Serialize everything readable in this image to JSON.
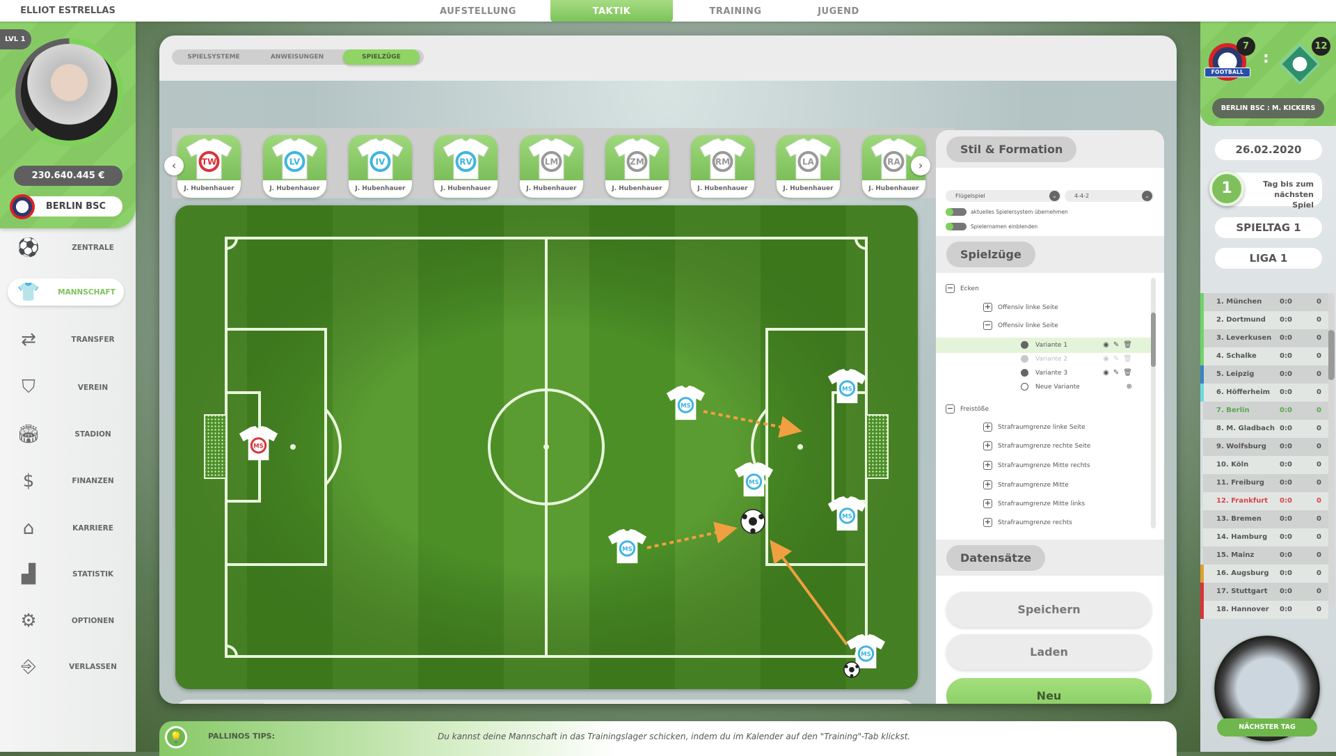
{
  "user": {
    "name": "ELLIOT ESTRELLAS",
    "level": "LVL 1",
    "level_progress": 0.62,
    "money": "230.640.445 €",
    "club": "BERLIN BSC"
  },
  "top_tabs": [
    {
      "label": "AUFSTELLUNG",
      "active": false
    },
    {
      "label": "TAKTIK",
      "active": true
    },
    {
      "label": "TRAINING",
      "active": false
    },
    {
      "label": "JUGEND",
      "active": false
    }
  ],
  "nav": [
    {
      "label": "ZENTRALE",
      "icon": "football-icon",
      "glyph": "⚽",
      "active": false
    },
    {
      "label": "MANNSCHAFT",
      "icon": "jerseys-icon",
      "glyph": "👕",
      "active": true
    },
    {
      "label": "TRANSFER",
      "icon": "transfer-icon",
      "glyph": "⇄",
      "active": false
    },
    {
      "label": "VEREIN",
      "icon": "club-shield-icon",
      "glyph": "⛉",
      "active": false
    },
    {
      "label": "STADION",
      "icon": "stadium-icon",
      "glyph": "🏟",
      "active": false
    },
    {
      "label": "FINANZEN",
      "icon": "money-icon",
      "glyph": "$",
      "active": false
    },
    {
      "label": "KARRIERE",
      "icon": "home-icon",
      "glyph": "⌂",
      "active": false
    },
    {
      "label": "STATISTIK",
      "icon": "statistics-icon",
      "glyph": "▟",
      "active": false
    },
    {
      "label": "OPTIONEN",
      "icon": "gear-icon",
      "glyph": "⚙",
      "active": false
    },
    {
      "label": "VERLASSEN",
      "icon": "exit-door-icon",
      "glyph": "⎆",
      "active": false
    }
  ],
  "subtabs": [
    {
      "label": "SPIELSYSTEME",
      "active": false
    },
    {
      "label": "ANWEISUNGEN",
      "active": false
    },
    {
      "label": "SPIELZÜGE",
      "active": true
    }
  ],
  "player_cards": [
    {
      "pos": "TW",
      "name": "J. Hubenhauer",
      "color": "#d9333a"
    },
    {
      "pos": "LV",
      "name": "J. Hubenhauer",
      "color": "#3fb5e0"
    },
    {
      "pos": "IV",
      "name": "J. Hubenhauer",
      "color": "#3fb5e0"
    },
    {
      "pos": "RV",
      "name": "J. Hubenhauer",
      "color": "#3fb5e0"
    },
    {
      "pos": "LM",
      "name": "J. Hubenhauer",
      "color": "#999999"
    },
    {
      "pos": "ZM",
      "name": "J. Hubenhauer",
      "color": "#999999"
    },
    {
      "pos": "RM",
      "name": "J. Hubenhauer",
      "color": "#999999"
    },
    {
      "pos": "LA",
      "name": "J. Hubenhauer",
      "color": "#999999"
    },
    {
      "pos": "RA",
      "name": "J. Hubenhauer",
      "color": "#999999"
    }
  ],
  "pitch_players": [
    {
      "label": "MS",
      "color": "#d9333a"
    },
    {
      "label": "MS",
      "color": "#3fb5e0"
    },
    {
      "label": "MS",
      "color": "#3fb5e0"
    },
    {
      "label": "MS",
      "color": "#3fb5e0"
    },
    {
      "label": "MS",
      "color": "#3fb5e0"
    },
    {
      "label": "MS",
      "color": "#3fb5e0"
    },
    {
      "label": "MS",
      "color": "#3fb5e0"
    }
  ],
  "timeline": {
    "total_steps": 14,
    "marked_steps": [
      3,
      7
    ]
  },
  "settings": {
    "style_title": "Stil & Formation",
    "style_value": "Flügelspiel",
    "formation_value": "4-4-2",
    "toggle1": "aktuelles Spielersystem übernehmen",
    "toggle2": "Spielernamen einblenden",
    "plays_title": "Spielzüge",
    "tree": [
      {
        "level": 0,
        "type": "minus",
        "label": "Ecken"
      },
      {
        "level": 1,
        "type": "plus",
        "label": "Offensiv linke Seite"
      },
      {
        "level": 1,
        "type": "minus",
        "label": "Offensiv linke Seite"
      },
      {
        "level": 2,
        "type": "dot",
        "label": "Variante 1",
        "state": "selected"
      },
      {
        "level": 2,
        "type": "dot",
        "label": "Variante 2",
        "state": "disabled"
      },
      {
        "level": 2,
        "type": "dot",
        "label": "Variante 3",
        "state": "normal"
      },
      {
        "level": 2,
        "type": "new",
        "label": "Neue Variante",
        "state": "new"
      },
      {
        "level": 0,
        "type": "minus",
        "label": "Freistöße"
      },
      {
        "level": 1,
        "type": "plus",
        "label": "Strafraumgrenze linke Seite"
      },
      {
        "level": 1,
        "type": "plus",
        "label": "Strafraumgrenze rechte Seite"
      },
      {
        "level": 1,
        "type": "plus",
        "label": "Strafraumgrenze Mitte rechts"
      },
      {
        "level": 1,
        "type": "plus",
        "label": "Strafraumgrenze Mitte"
      },
      {
        "level": 1,
        "type": "plus",
        "label": "Strafraumgrenze Mitte links"
      },
      {
        "level": 1,
        "type": "plus",
        "label": "Strafraumgrenze rechts"
      }
    ],
    "data_title": "Datensätze",
    "save": "Speichern",
    "load": "Laden",
    "new": "Neu"
  },
  "match": {
    "home_rank": "7",
    "away_rank": "12",
    "separator": ":",
    "label": "BERLIN BSC : M. KICKERS",
    "home_badge_text": "FOOTBALL",
    "date": "26.02.2020",
    "days": "1",
    "days_label": "Tag bis zum nächsten Spiel",
    "matchday": "SPIELTAG 1",
    "league": "LIGA 1"
  },
  "standings": [
    {
      "pos": "1.",
      "team": "München",
      "score": "0:0",
      "pts": "0",
      "zone": "#6fd36a"
    },
    {
      "pos": "2.",
      "team": "Dortmund",
      "score": "0:0",
      "pts": "0",
      "zone": "#6fd36a"
    },
    {
      "pos": "3.",
      "team": "Leverkusen",
      "score": "0:0",
      "pts": "0",
      "zone": "#6fd36a"
    },
    {
      "pos": "4.",
      "team": "Schalke",
      "score": "0:0",
      "pts": "0",
      "zone": "#6fd36a"
    },
    {
      "pos": "5.",
      "team": "Leipzig",
      "score": "0:0",
      "pts": "0",
      "zone": "#3c82c4"
    },
    {
      "pos": "6.",
      "team": "Höfferheim",
      "score": "0:0",
      "pts": "0",
      "zone": "#6fd8de"
    },
    {
      "pos": "7.",
      "team": "Berlin",
      "score": "0:0",
      "pts": "0",
      "highlight": "#5aa84a"
    },
    {
      "pos": "8.",
      "team": "M. Gladbach",
      "score": "0:0",
      "pts": "0"
    },
    {
      "pos": "9.",
      "team": "Wolfsburg",
      "score": "0:0",
      "pts": "0"
    },
    {
      "pos": "10.",
      "team": "Köln",
      "score": "0:0",
      "pts": "0"
    },
    {
      "pos": "11.",
      "team": "Freiburg",
      "score": "0:0",
      "pts": "0"
    },
    {
      "pos": "12.",
      "team": "Frankfurt",
      "score": "0:0",
      "pts": "0",
      "highlight": "#d9444a"
    },
    {
      "pos": "13.",
      "team": "Bremen",
      "score": "0:0",
      "pts": "0"
    },
    {
      "pos": "14.",
      "team": "Hamburg",
      "score": "0:0",
      "pts": "0"
    },
    {
      "pos": "15.",
      "team": "Mainz",
      "score": "0:0",
      "pts": "0"
    },
    {
      "pos": "16.",
      "team": "Augsburg",
      "score": "0:0",
      "pts": "0",
      "zone": "#e0a030"
    },
    {
      "pos": "17.",
      "team": "Stuttgart",
      "score": "0:0",
      "pts": "0",
      "zone": "#d9333a"
    },
    {
      "pos": "18.",
      "team": "Hannover",
      "score": "0:0",
      "pts": "0",
      "zone": "#d9333a"
    }
  ],
  "next_day": "NÄCHSTER TAG",
  "tips": {
    "label": "PALLINOS TIPS:",
    "text": "Du kannst deine Mannschaft in das Trainingslager schicken, indem du  im Kalender auf den \"Training\"-Tab klickst."
  },
  "colors": {
    "accent": "#7cc35a",
    "dark": "#5f5f5f"
  }
}
